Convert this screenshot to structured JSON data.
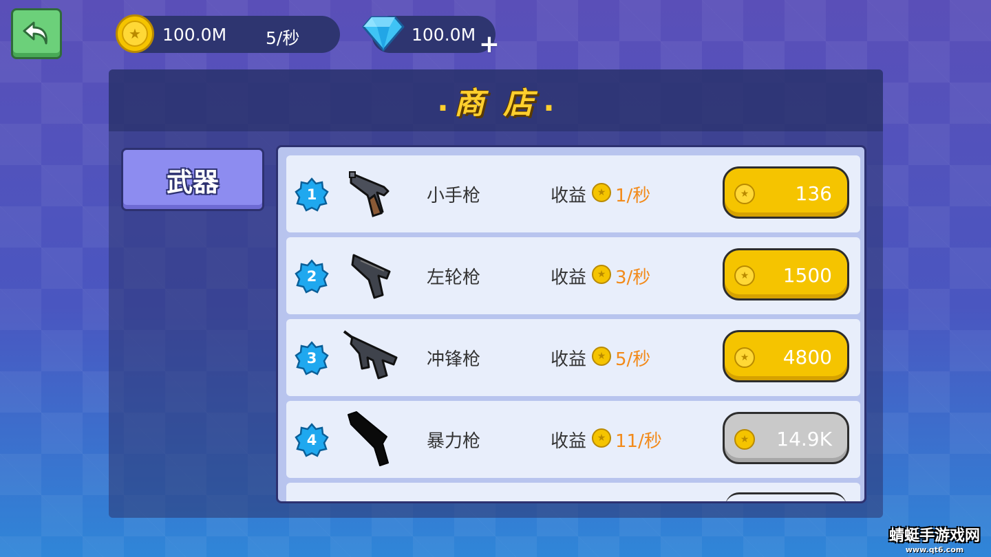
{
  "topbar": {
    "coins": "100.0M",
    "coin_rate": "5/秒",
    "gems": "100.0M"
  },
  "shop": {
    "title": "商 店",
    "category_tab": "武器",
    "income_label": "收益",
    "items": [
      {
        "level": "1",
        "name": "小手枪",
        "rate": "1/秒",
        "price": "136",
        "affordable": true,
        "icon": "revolver-icon"
      },
      {
        "level": "2",
        "name": "左轮枪",
        "rate": "3/秒",
        "price": "1500",
        "affordable": true,
        "icon": "pistol-icon"
      },
      {
        "level": "3",
        "name": "冲锋枪",
        "rate": "5/秒",
        "price": "4800",
        "affordable": true,
        "icon": "smg-icon"
      },
      {
        "level": "4",
        "name": "暴力枪",
        "rate": "11/秒",
        "price": "14.9K",
        "affordable": false,
        "icon": "shotgun-icon"
      }
    ]
  },
  "watermark": {
    "main": "蜻蜓手游戏网",
    "sub": "www.qt6.com"
  },
  "colors": {
    "accent_gold": "#f5c400",
    "income_orange": "#f28a1a",
    "back_green": "#6cd07a",
    "tab_purple": "#8d8cf0",
    "badge_blue": "#1fa8ef"
  }
}
